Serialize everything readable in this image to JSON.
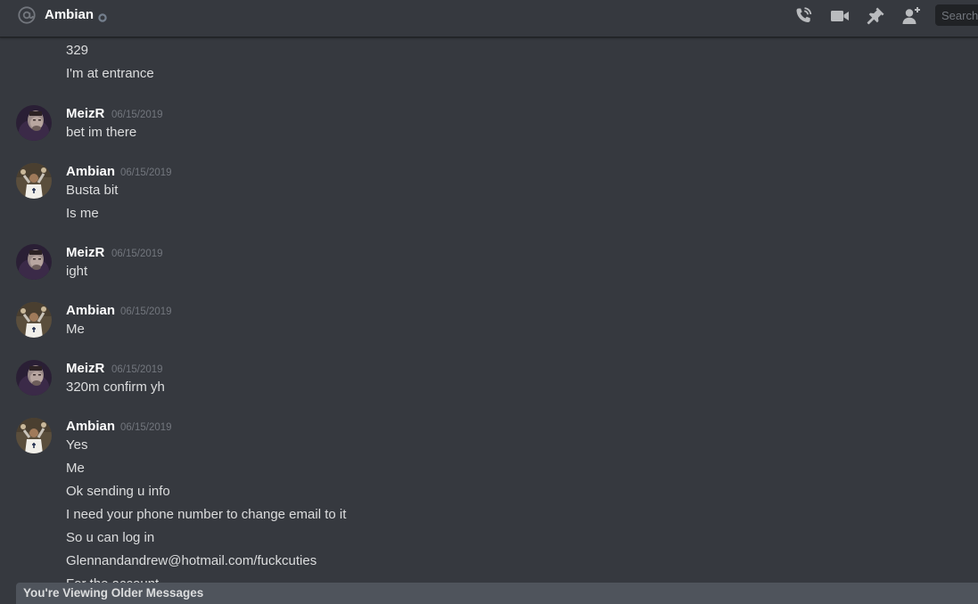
{
  "header": {
    "title": "Ambian",
    "at_icon": "at-sign-icon",
    "status_icon": "offline-status-icon",
    "actions": [
      {
        "name": "voice-call-icon"
      },
      {
        "name": "video-call-icon"
      },
      {
        "name": "pin-icon"
      },
      {
        "name": "add-friend-icon"
      }
    ],
    "search_placeholder": "Search"
  },
  "continuation": {
    "lines": [
      "329",
      "I'm at entrance"
    ]
  },
  "groups": [
    {
      "author": "MeizR",
      "avatar_icon": "meizr-avatar",
      "time": "06/15/2019",
      "lines": [
        "bet im there"
      ]
    },
    {
      "author": "Ambian",
      "avatar_icon": "ambian-avatar",
      "time": "06/15/2019",
      "lines": [
        "Busta bit",
        "Is me"
      ]
    },
    {
      "author": "MeizR",
      "avatar_icon": "meizr-avatar",
      "time": "06/15/2019",
      "lines": [
        "ight"
      ]
    },
    {
      "author": "Ambian",
      "avatar_icon": "ambian-avatar",
      "time": "06/15/2019",
      "lines": [
        "Me"
      ]
    },
    {
      "author": "MeizR",
      "avatar_icon": "meizr-avatar",
      "time": "06/15/2019",
      "lines": [
        "320m confirm yh"
      ]
    },
    {
      "author": "Ambian",
      "avatar_icon": "ambian-avatar",
      "time": "06/15/2019",
      "lines": [
        "Yes",
        "Me",
        "Ok sending u info",
        "I need your phone number to change email to it",
        "So u can log in",
        "Glennandandrew@hotmail.com/fuckcuties",
        "For the account"
      ]
    }
  ],
  "older_bar": {
    "label": "You're Viewing Older Messages"
  },
  "colors": {
    "background": "#36393f",
    "header_border": "#202225",
    "username": "#ffffff",
    "message_text": "#dcddde",
    "timestamp": "#72767d",
    "icon": "#b9bbbe",
    "older_bar": "#4f545c"
  }
}
